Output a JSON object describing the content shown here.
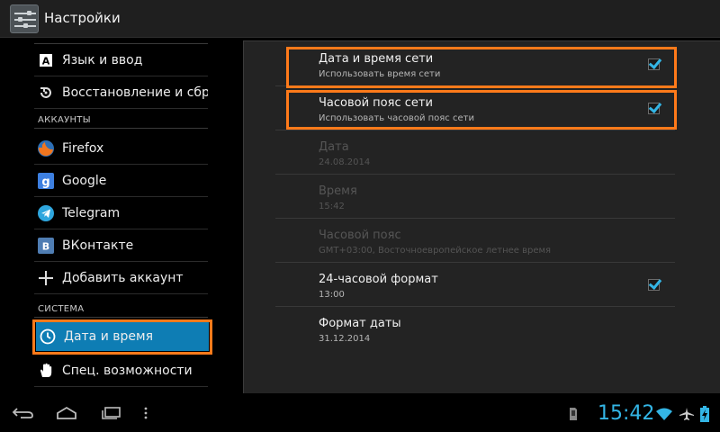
{
  "app": {
    "title": "Настройки",
    "icon": "settings-icon"
  },
  "sidebar": {
    "items": [
      {
        "label": "Язык и ввод",
        "icon": "keyboard-icon"
      },
      {
        "label": "Восстановление и сброс",
        "icon": "restore-icon"
      },
      {
        "label": "Firefox",
        "icon": "firefox-icon"
      },
      {
        "label": "Google",
        "icon": "google-icon"
      },
      {
        "label": "Telegram",
        "icon": "telegram-icon"
      },
      {
        "label": "ВКонтакте",
        "icon": "vk-icon"
      },
      {
        "label": "Добавить аккаунт",
        "icon": "plus-icon"
      },
      {
        "label": "Дата и время",
        "icon": "clock-icon",
        "selected": true
      },
      {
        "label": "Спец. возможности",
        "icon": "hand-icon"
      }
    ],
    "headers": {
      "accounts": "АККАУНТЫ",
      "system": "СИСТЕМА"
    }
  },
  "prefs": [
    {
      "title": "Дата и время сети",
      "summary": "Использовать время сети",
      "checked": true,
      "enabled": true
    },
    {
      "title": "Часовой пояс сети",
      "summary": "Использовать часовой пояс сети",
      "checked": true,
      "enabled": true
    },
    {
      "title": "Дата",
      "summary": "24.08.2014",
      "enabled": false
    },
    {
      "title": "Время",
      "summary": "15:42",
      "enabled": false
    },
    {
      "title": "Часовой пояс",
      "summary": "GMT+03:00, Восточноевропейское летнее время",
      "enabled": false
    },
    {
      "title": "24-часовой формат",
      "summary": "13:00",
      "checked": true,
      "enabled": true
    },
    {
      "title": "Формат даты",
      "summary": "31.12.2014",
      "enabled": true
    }
  ],
  "status": {
    "time": "15:42"
  },
  "colors": {
    "accent": "#33b5e5",
    "selected": "#0e7db4",
    "highlight": "#ff7a1a"
  }
}
